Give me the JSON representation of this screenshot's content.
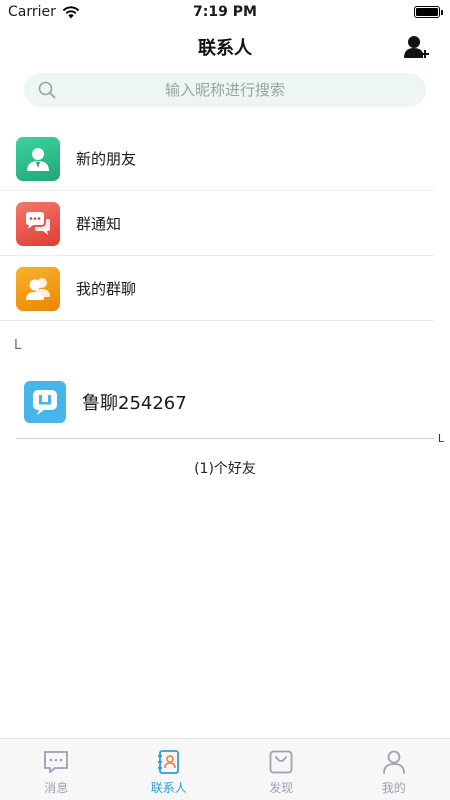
{
  "status_bar": {
    "carrier": "Carrier",
    "time": "7:19 PM"
  },
  "header": {
    "title": "联系人"
  },
  "search": {
    "placeholder": "输入昵称进行搜索"
  },
  "menu": [
    {
      "label": "新的朋友",
      "icon": "new-friend-icon",
      "color": "#2fbd8a"
    },
    {
      "label": "群通知",
      "icon": "group-notice-icon",
      "color": "#ec5a4e"
    },
    {
      "label": "我的群聊",
      "icon": "group-chat-icon",
      "color": "#f39a12"
    }
  ],
  "contacts": {
    "section_letter": "L",
    "items": [
      {
        "name": "鲁聊254267",
        "avatar_color": "#46b6ea"
      }
    ],
    "index_letter": "L",
    "count_text": "(1)个好友"
  },
  "tabs": [
    {
      "label": "消息",
      "icon": "message-icon",
      "active": false
    },
    {
      "label": "联系人",
      "icon": "contacts-icon",
      "active": true
    },
    {
      "label": "发现",
      "icon": "discover-icon",
      "active": false
    },
    {
      "label": "我的",
      "icon": "profile-icon",
      "active": false
    }
  ],
  "colors": {
    "accent": "#2a9fd8",
    "inactive": "#a0a0b0",
    "search_bg": "#eef6f4"
  }
}
